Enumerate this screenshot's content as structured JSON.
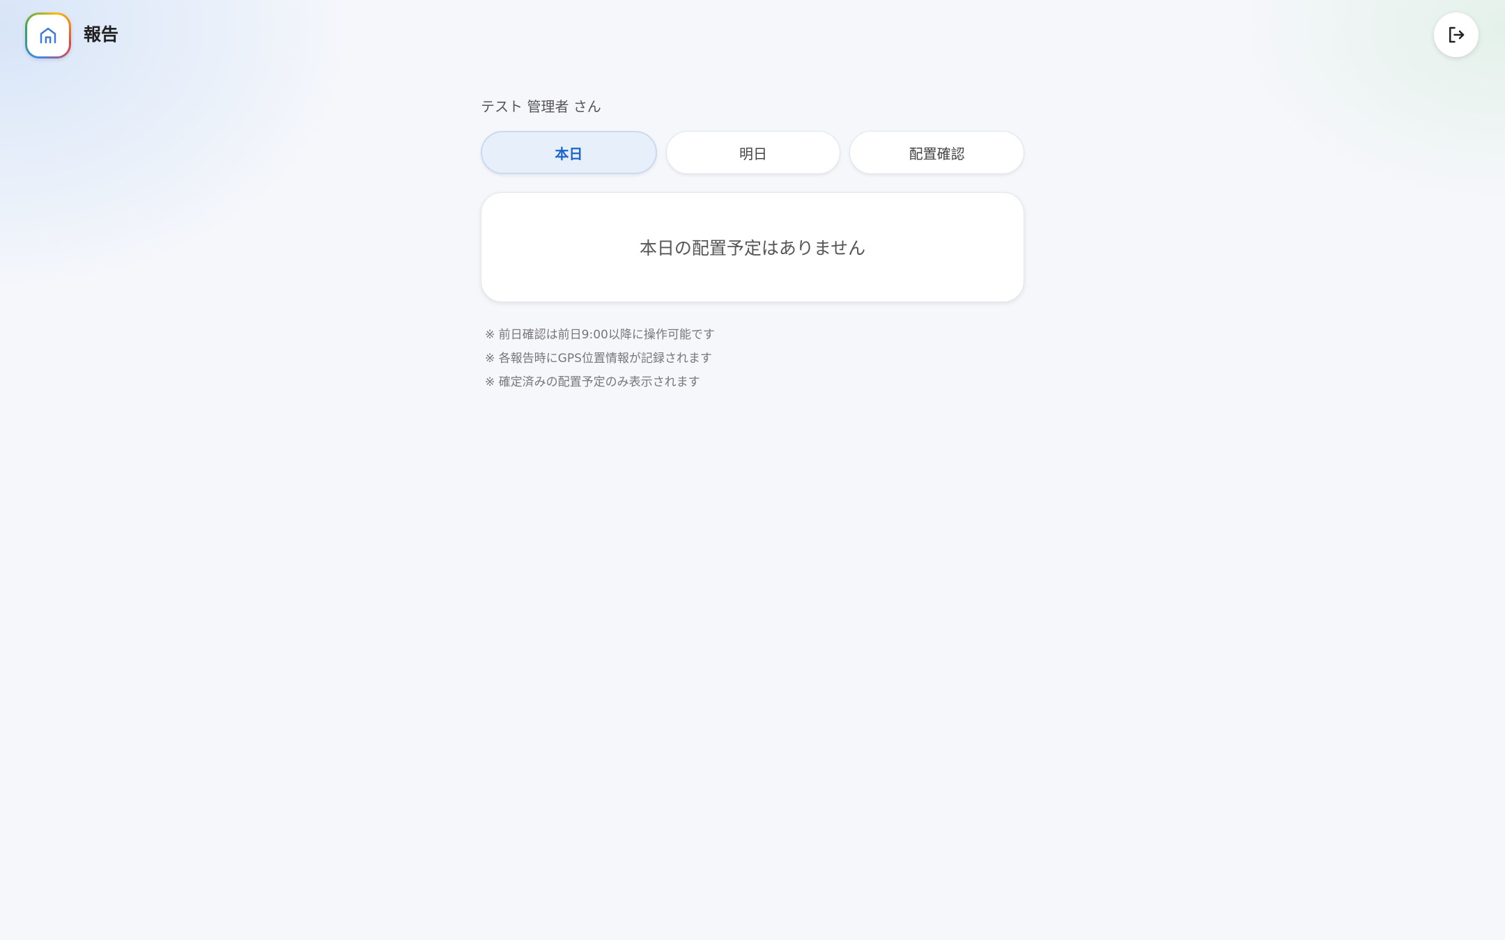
{
  "header": {
    "title": "報告",
    "logo_icon": "home-icon",
    "logout_icon": "logout-icon"
  },
  "main": {
    "greeting": "テスト 管理者 さん",
    "tabs": [
      {
        "label": "本日",
        "active": true
      },
      {
        "label": "明日",
        "active": false
      },
      {
        "label": "配置確認",
        "active": false
      }
    ],
    "empty_message": "本日の配置予定はありません",
    "notes": [
      "※ 前日確認は前日9:00以降に操作可能です",
      "※ 各報告時にGPS位置情報が記録されます",
      "※ 確定済みの配置予定のみ表示されます"
    ]
  },
  "colors": {
    "accent": "#1a66cc",
    "active_tab_bg": "#e7effb",
    "background": "#f5f7fb"
  }
}
